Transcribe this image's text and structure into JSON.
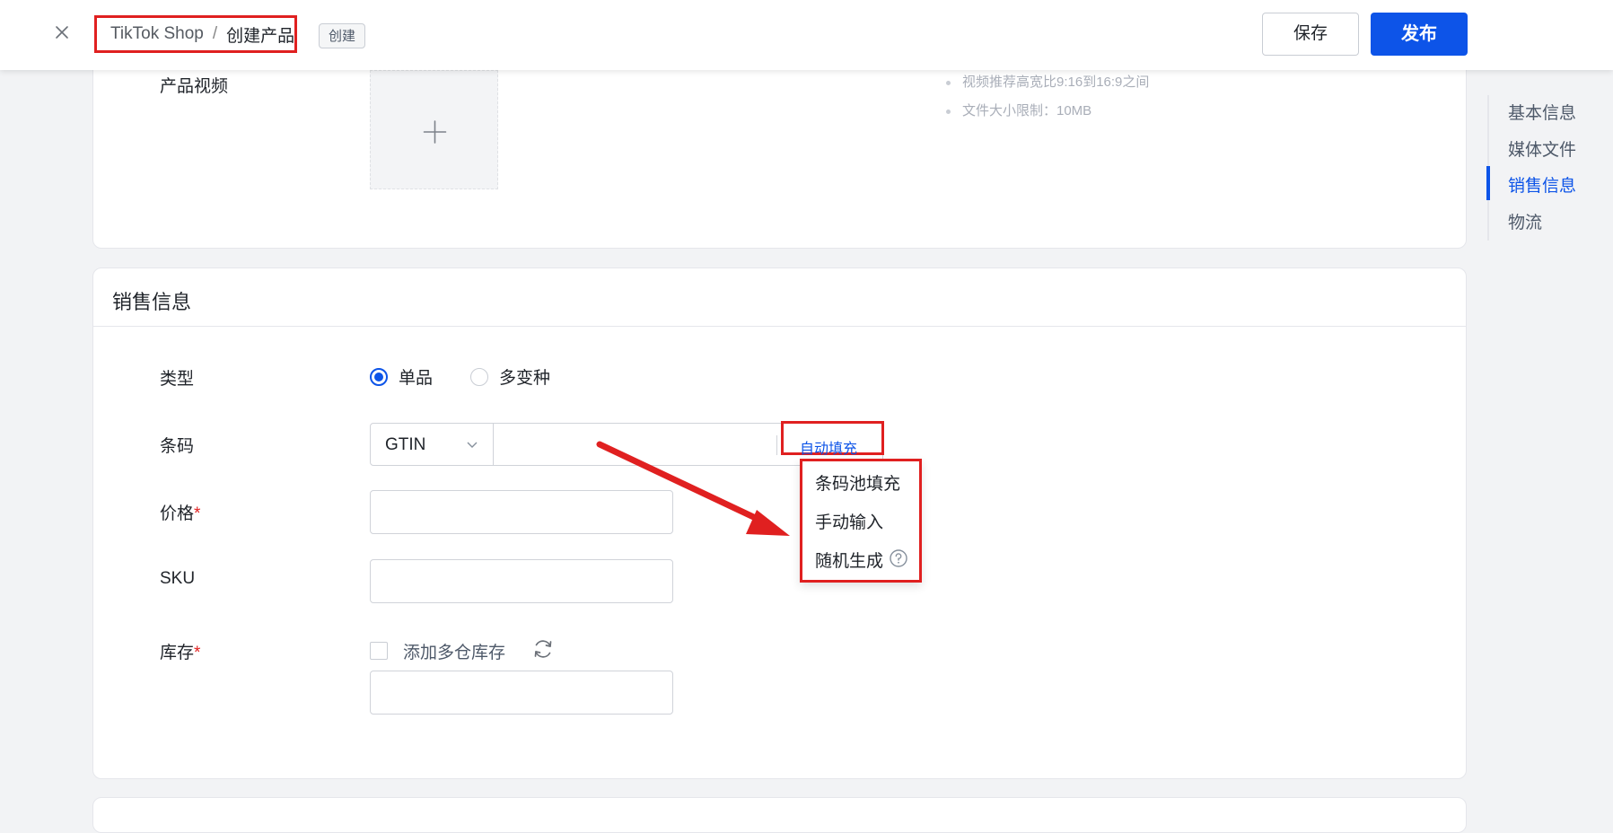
{
  "header": {
    "close_icon": "close-icon",
    "breadcrumb": {
      "root": "TikTok Shop",
      "separator": "/",
      "current": "创建产品"
    },
    "status_tag": "创建",
    "save_label": "保存",
    "publish_label": "发布"
  },
  "media": {
    "video_label": "产品视频",
    "upload_icon": "plus-icon",
    "hints": [
      "视频推荐高宽比9:16到16:9之间",
      "文件大小限制：10MB"
    ]
  },
  "sales": {
    "title": "销售信息",
    "type_label": "类型",
    "type_options": [
      {
        "label": "单品",
        "selected": true
      },
      {
        "label": "多变种",
        "selected": false
      }
    ],
    "barcode_label": "条码",
    "barcode_type": "GTIN",
    "barcode_value": "",
    "autofill_label": "自动填充",
    "price_label": "价格",
    "price_required": "*",
    "price_value": "",
    "sku_label": "SKU",
    "sku_value": "",
    "stock_label": "库存",
    "stock_required": "*",
    "multi_warehouse_label": "添加多仓库存",
    "multi_warehouse_checked": false,
    "stock_value": ""
  },
  "autofill_menu": {
    "items": [
      "条码池填充",
      "手动输入",
      "随机生成"
    ],
    "help_icon": "question-circle-icon"
  },
  "side_nav": {
    "items": [
      "基本信息",
      "媒体文件",
      "销售信息",
      "物流"
    ],
    "active": "销售信息"
  },
  "colors": {
    "accent": "#0d54e8",
    "annotation_red": "#e02020",
    "required": "#e02020"
  }
}
